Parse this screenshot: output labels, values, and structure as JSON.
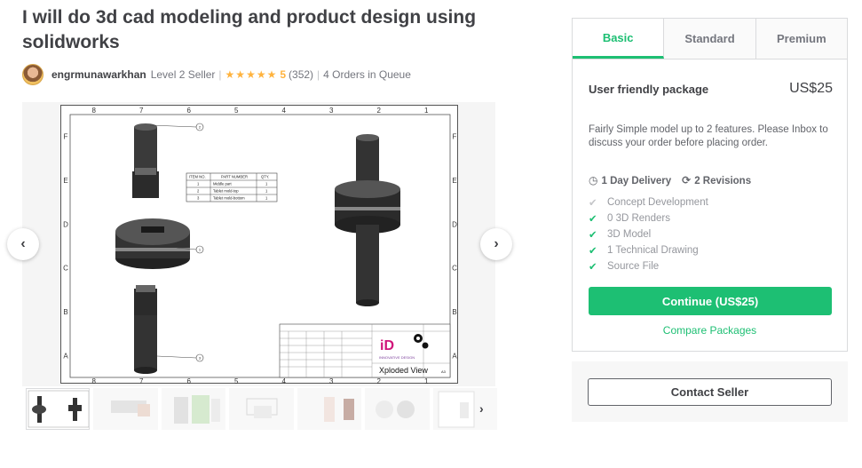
{
  "gig": {
    "title": "I will do 3d cad modeling and product design using solidworks"
  },
  "seller": {
    "name": "engrmunawarkhan",
    "level": "Level 2 Seller",
    "stars": "★★★★★",
    "rating": "5",
    "reviews": "(352)",
    "queue": "4 Orders in Queue"
  },
  "gallery": {
    "prev_icon": "chevron-left-icon",
    "next_icon": "chevron-right-icon",
    "drawing": {
      "col_labels": [
        "8",
        "7",
        "6",
        "5",
        "4",
        "3",
        "2",
        "1"
      ],
      "row_labels": [
        "F",
        "E",
        "D",
        "C",
        "B",
        "A"
      ],
      "bom_headers": [
        "ITEM NO.",
        "PART NUMBER",
        "QTY."
      ],
      "bom_rows": [
        [
          "1",
          "Middle part",
          "1"
        ],
        [
          "2",
          "Tablet mold-top",
          "1"
        ],
        [
          "3",
          "Tablet mold-bottom",
          "1"
        ]
      ],
      "balloons": [
        "2",
        "1",
        "3"
      ],
      "view_label": "Xploded View",
      "logo_text": "iD",
      "logo_sub": "INNOVATIVE DESIGN",
      "sheet_size": "A3"
    },
    "thumbnail_count": 7
  },
  "package": {
    "tabs": [
      "Basic",
      "Standard",
      "Premium"
    ],
    "active_tab": "Basic",
    "name": "User friendly package",
    "price": "US$25",
    "description": "Fairly Simple model up to 2 features. Please Inbox to discuss your order before placing order.",
    "delivery": "1 Day Delivery",
    "revisions": "2 Revisions",
    "features": [
      {
        "label": "Concept Development",
        "included": false
      },
      {
        "label": "0 3D Renders",
        "included": true
      },
      {
        "label": "3D Model",
        "included": true
      },
      {
        "label": "1 Technical Drawing",
        "included": true
      },
      {
        "label": "Source File",
        "included": true
      }
    ],
    "continue_label": "Continue (US$25)",
    "compare_label": "Compare Packages"
  },
  "contact": {
    "label": "Contact Seller"
  },
  "colors": {
    "accent": "#1dbf73",
    "star": "#ffb33e",
    "text": "#404145"
  }
}
